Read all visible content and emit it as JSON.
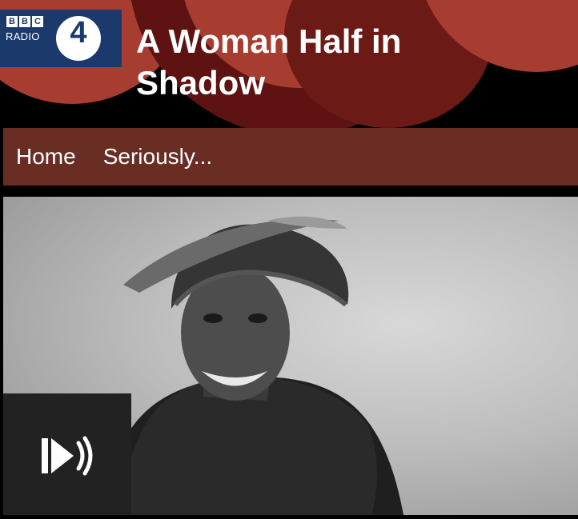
{
  "brand": {
    "bbc_letters": [
      "B",
      "B",
      "C"
    ],
    "radio_label": "RADIO",
    "station_number": "4",
    "color": "#1b3a6b"
  },
  "header": {
    "title_line1": "A Woman Half in",
    "title_line2": "Shadow"
  },
  "nav": {
    "items": [
      {
        "label": "Home"
      },
      {
        "label": "Seriously..."
      }
    ],
    "background": "#6a2d23"
  },
  "hero": {
    "subject": "black-and-white portrait photo",
    "play_icon": "podcast-play-icon"
  }
}
